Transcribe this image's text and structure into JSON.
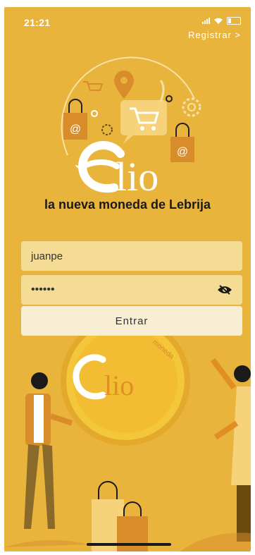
{
  "status": {
    "time": "21:21"
  },
  "header": {
    "registrar_label": "Registrar >"
  },
  "logo": {
    "brand_text": "lio",
    "tagline": "la nueva moneda de Lebrija"
  },
  "login": {
    "username_value": "juanpe",
    "password_value": "••••••",
    "submit_label": "Entrar"
  },
  "coin": {
    "brand_text": "lio",
    "edge_text": "moneda"
  },
  "colors": {
    "background": "#e9b43c",
    "field": "#f5dc94",
    "button": "#f8eed3",
    "coin": "#f4c63a"
  }
}
